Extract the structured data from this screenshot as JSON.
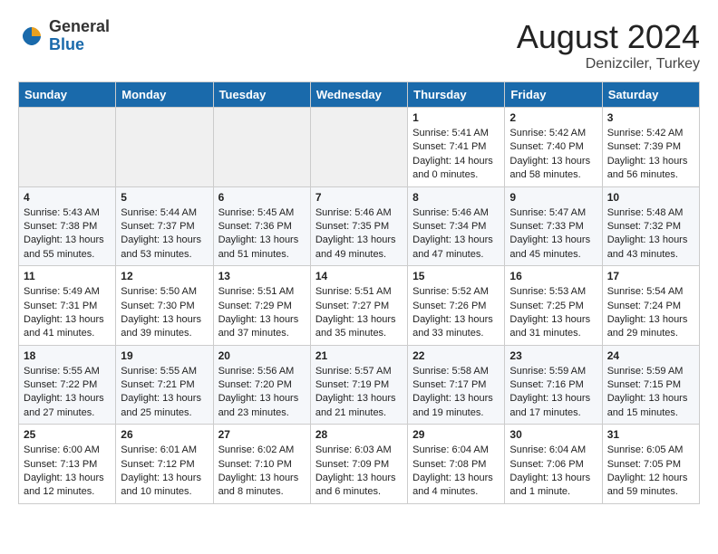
{
  "logo": {
    "general": "General",
    "blue": "Blue"
  },
  "title": {
    "month_year": "August 2024",
    "location": "Denizciler, Turkey"
  },
  "headers": [
    "Sunday",
    "Monday",
    "Tuesday",
    "Wednesday",
    "Thursday",
    "Friday",
    "Saturday"
  ],
  "weeks": [
    [
      {
        "day": "",
        "content": ""
      },
      {
        "day": "",
        "content": ""
      },
      {
        "day": "",
        "content": ""
      },
      {
        "day": "",
        "content": ""
      },
      {
        "day": "1",
        "content": "Sunrise: 5:41 AM\nSunset: 7:41 PM\nDaylight: 14 hours\nand 0 minutes."
      },
      {
        "day": "2",
        "content": "Sunrise: 5:42 AM\nSunset: 7:40 PM\nDaylight: 13 hours\nand 58 minutes."
      },
      {
        "day": "3",
        "content": "Sunrise: 5:42 AM\nSunset: 7:39 PM\nDaylight: 13 hours\nand 56 minutes."
      }
    ],
    [
      {
        "day": "4",
        "content": "Sunrise: 5:43 AM\nSunset: 7:38 PM\nDaylight: 13 hours\nand 55 minutes."
      },
      {
        "day": "5",
        "content": "Sunrise: 5:44 AM\nSunset: 7:37 PM\nDaylight: 13 hours\nand 53 minutes."
      },
      {
        "day": "6",
        "content": "Sunrise: 5:45 AM\nSunset: 7:36 PM\nDaylight: 13 hours\nand 51 minutes."
      },
      {
        "day": "7",
        "content": "Sunrise: 5:46 AM\nSunset: 7:35 PM\nDaylight: 13 hours\nand 49 minutes."
      },
      {
        "day": "8",
        "content": "Sunrise: 5:46 AM\nSunset: 7:34 PM\nDaylight: 13 hours\nand 47 minutes."
      },
      {
        "day": "9",
        "content": "Sunrise: 5:47 AM\nSunset: 7:33 PM\nDaylight: 13 hours\nand 45 minutes."
      },
      {
        "day": "10",
        "content": "Sunrise: 5:48 AM\nSunset: 7:32 PM\nDaylight: 13 hours\nand 43 minutes."
      }
    ],
    [
      {
        "day": "11",
        "content": "Sunrise: 5:49 AM\nSunset: 7:31 PM\nDaylight: 13 hours\nand 41 minutes."
      },
      {
        "day": "12",
        "content": "Sunrise: 5:50 AM\nSunset: 7:30 PM\nDaylight: 13 hours\nand 39 minutes."
      },
      {
        "day": "13",
        "content": "Sunrise: 5:51 AM\nSunset: 7:29 PM\nDaylight: 13 hours\nand 37 minutes."
      },
      {
        "day": "14",
        "content": "Sunrise: 5:51 AM\nSunset: 7:27 PM\nDaylight: 13 hours\nand 35 minutes."
      },
      {
        "day": "15",
        "content": "Sunrise: 5:52 AM\nSunset: 7:26 PM\nDaylight: 13 hours\nand 33 minutes."
      },
      {
        "day": "16",
        "content": "Sunrise: 5:53 AM\nSunset: 7:25 PM\nDaylight: 13 hours\nand 31 minutes."
      },
      {
        "day": "17",
        "content": "Sunrise: 5:54 AM\nSunset: 7:24 PM\nDaylight: 13 hours\nand 29 minutes."
      }
    ],
    [
      {
        "day": "18",
        "content": "Sunrise: 5:55 AM\nSunset: 7:22 PM\nDaylight: 13 hours\nand 27 minutes."
      },
      {
        "day": "19",
        "content": "Sunrise: 5:55 AM\nSunset: 7:21 PM\nDaylight: 13 hours\nand 25 minutes."
      },
      {
        "day": "20",
        "content": "Sunrise: 5:56 AM\nSunset: 7:20 PM\nDaylight: 13 hours\nand 23 minutes."
      },
      {
        "day": "21",
        "content": "Sunrise: 5:57 AM\nSunset: 7:19 PM\nDaylight: 13 hours\nand 21 minutes."
      },
      {
        "day": "22",
        "content": "Sunrise: 5:58 AM\nSunset: 7:17 PM\nDaylight: 13 hours\nand 19 minutes."
      },
      {
        "day": "23",
        "content": "Sunrise: 5:59 AM\nSunset: 7:16 PM\nDaylight: 13 hours\nand 17 minutes."
      },
      {
        "day": "24",
        "content": "Sunrise: 5:59 AM\nSunset: 7:15 PM\nDaylight: 13 hours\nand 15 minutes."
      }
    ],
    [
      {
        "day": "25",
        "content": "Sunrise: 6:00 AM\nSunset: 7:13 PM\nDaylight: 13 hours\nand 12 minutes."
      },
      {
        "day": "26",
        "content": "Sunrise: 6:01 AM\nSunset: 7:12 PM\nDaylight: 13 hours\nand 10 minutes."
      },
      {
        "day": "27",
        "content": "Sunrise: 6:02 AM\nSunset: 7:10 PM\nDaylight: 13 hours\nand 8 minutes."
      },
      {
        "day": "28",
        "content": "Sunrise: 6:03 AM\nSunset: 7:09 PM\nDaylight: 13 hours\nand 6 minutes."
      },
      {
        "day": "29",
        "content": "Sunrise: 6:04 AM\nSunset: 7:08 PM\nDaylight: 13 hours\nand 4 minutes."
      },
      {
        "day": "30",
        "content": "Sunrise: 6:04 AM\nSunset: 7:06 PM\nDaylight: 13 hours\nand 1 minute."
      },
      {
        "day": "31",
        "content": "Sunrise: 6:05 AM\nSunset: 7:05 PM\nDaylight: 12 hours\nand 59 minutes."
      }
    ]
  ]
}
